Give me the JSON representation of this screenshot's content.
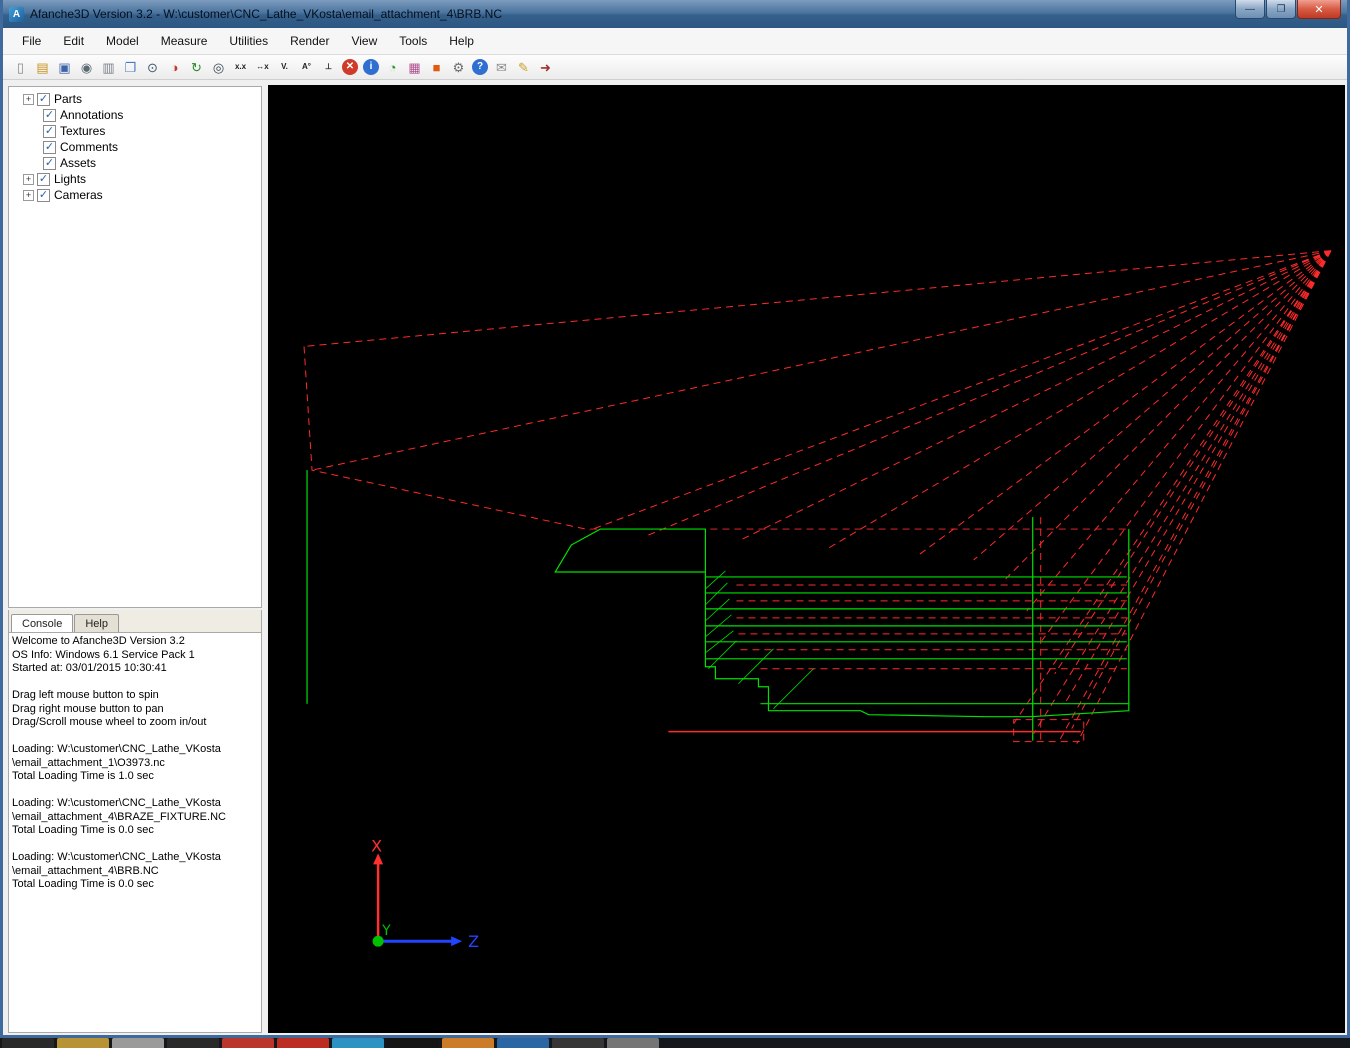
{
  "window": {
    "title": "Afanche3D Version 3.2 - W:\\customer\\CNC_Lathe_VKosta\\email_attachment_4\\BRB.NC",
    "app_icon_letter": "A",
    "controls": {
      "minimize": "—",
      "maximize": "❐",
      "close": "✕"
    }
  },
  "menu": {
    "items": [
      "File",
      "Edit",
      "Model",
      "Measure",
      "Utilities",
      "Render",
      "View",
      "Tools",
      "Help"
    ]
  },
  "toolbar": {
    "icons": [
      {
        "name": "new-file",
        "glyph": "▯",
        "fg": "#8a8a8a"
      },
      {
        "name": "open-folder",
        "glyph": "▤",
        "fg": "#c8941e"
      },
      {
        "name": "save",
        "glyph": "▣",
        "fg": "#3e62a8"
      },
      {
        "name": "screenshot-camera",
        "glyph": "◉",
        "fg": "#5a6a72"
      },
      {
        "name": "print",
        "glyph": "▥",
        "fg": "#7a7f88"
      },
      {
        "name": "copy-pages",
        "glyph": "❐",
        "fg": "#4a7ac0"
      },
      {
        "name": "view-eyes",
        "glyph": "⊙",
        "fg": "#41596e"
      },
      {
        "name": "render-globe",
        "glyph": "◑",
        "fg": "#c23a2a"
      },
      {
        "name": "rotate-3d",
        "glyph": "↻",
        "fg": "#2a8a2a"
      },
      {
        "name": "measure-binoculars",
        "glyph": "◎",
        "fg": "#37474f"
      },
      {
        "name": "measure-distance",
        "glyph": "x.x",
        "fg": "#222",
        "small": true
      },
      {
        "name": "measure-width",
        "glyph": "↔x",
        "fg": "#222",
        "small": true
      },
      {
        "name": "measure-vertex",
        "glyph": "V.",
        "fg": "#222",
        "small": true
      },
      {
        "name": "measure-angle",
        "glyph": "A°",
        "fg": "#222",
        "small": true
      },
      {
        "name": "measure-perpendicular",
        "glyph": "⊥",
        "fg": "#222",
        "small": true
      },
      {
        "name": "stop",
        "glyph": "✕",
        "fg": "#fff",
        "bg": "#d03a2a",
        "circle": true
      },
      {
        "name": "info",
        "glyph": "i",
        "fg": "#fff",
        "bg": "#2f6fd0",
        "circle": true
      },
      {
        "name": "power-clock",
        "glyph": "◔",
        "fg": "#1d941d"
      },
      {
        "name": "grid-colors",
        "glyph": "▦",
        "fg": "#b05090"
      },
      {
        "name": "color-swatch",
        "glyph": "■",
        "fg": "#e05a10"
      },
      {
        "name": "settings-gear",
        "glyph": "⚙",
        "fg": "#6a6a6a"
      },
      {
        "name": "help",
        "glyph": "?",
        "fg": "#fff",
        "bg": "#2f6fd0",
        "circle": true
      },
      {
        "name": "email",
        "glyph": "✉",
        "fg": "#8a8a8a"
      },
      {
        "name": "annotate-note",
        "glyph": "✎",
        "fg": "#c9a227"
      },
      {
        "name": "exit",
        "glyph": "➜",
        "fg": "#a03030"
      }
    ]
  },
  "tree": {
    "items": [
      {
        "label": "Parts",
        "expander": true,
        "checked": true,
        "level": 0
      },
      {
        "label": "Annotations",
        "expander": false,
        "checked": true,
        "level": 1
      },
      {
        "label": "Textures",
        "expander": false,
        "checked": true,
        "level": 1
      },
      {
        "label": "Comments",
        "expander": false,
        "checked": true,
        "level": 1
      },
      {
        "label": "Assets",
        "expander": false,
        "checked": true,
        "level": 1
      },
      {
        "label": "Lights",
        "expander": true,
        "checked": true,
        "level": 0
      },
      {
        "label": "Cameras",
        "expander": true,
        "checked": true,
        "level": 0
      }
    ]
  },
  "console_panel": {
    "tabs": [
      {
        "label": "Console",
        "active": true
      },
      {
        "label": "Help",
        "active": false
      }
    ],
    "lines": [
      "Welcome to Afanche3D Version 3.2",
      "OS Info: Windows 6.1 Service Pack 1",
      "Started at: 03/01/2015 10:30:41",
      "",
      "Drag left mouse button to spin",
      "Drag right mouse button to pan",
      "Drag/Scroll mouse wheel to zoom in/out",
      "",
      "Loading: W:\\customer\\CNC_Lathe_VKosta",
      "\\email_attachment_1\\O3973.nc",
      "Total Loading Time is 1.0 sec",
      "",
      "Loading: W:\\customer\\CNC_Lathe_VKosta",
      "\\email_attachment_4\\BRAZE_FIXTURE.NC",
      "Total Loading Time is 0.0 sec",
      "",
      "Loading: W:\\customer\\CNC_Lathe_VKosta",
      "\\email_attachment_4\\BRB.NC",
      "Total Loading Time is 0.0 sec"
    ]
  },
  "viewport": {
    "axes": {
      "x": "X",
      "y": "Y",
      "z": "Z"
    },
    "colors": {
      "background": "#000000",
      "toolpath_rapid": "#ff2a2a",
      "toolpath_feed": "#00e000",
      "axis_x": "#ff3030",
      "axis_y": "#00c000",
      "axis_z": "#2244ff"
    }
  },
  "taskbar": {
    "items": [
      {
        "name": "taskbar-app-1",
        "color": "#2b2b2b"
      },
      {
        "name": "taskbar-app-2",
        "color": "#caa13a"
      },
      {
        "name": "taskbar-app-3",
        "color": "#a8a8a8"
      },
      {
        "name": "taskbar-app-4",
        "color": "#2b2b2b"
      },
      {
        "name": "taskbar-app-5",
        "color": "#cc3a2c"
      },
      {
        "name": "taskbar-app-6",
        "color": "#cf2f24"
      },
      {
        "name": "taskbar-app-7",
        "color": "#2f9fd6"
      },
      {
        "name": "taskbar-app-8",
        "color": "#151515"
      },
      {
        "name": "taskbar-app-9",
        "color": "#e0862a"
      },
      {
        "name": "taskbar-app-10",
        "color": "#2b6fb2"
      },
      {
        "name": "taskbar-app-11",
        "color": "#3a3a3a"
      },
      {
        "name": "taskbar-app-12",
        "color": "#808080"
      }
    ]
  }
}
